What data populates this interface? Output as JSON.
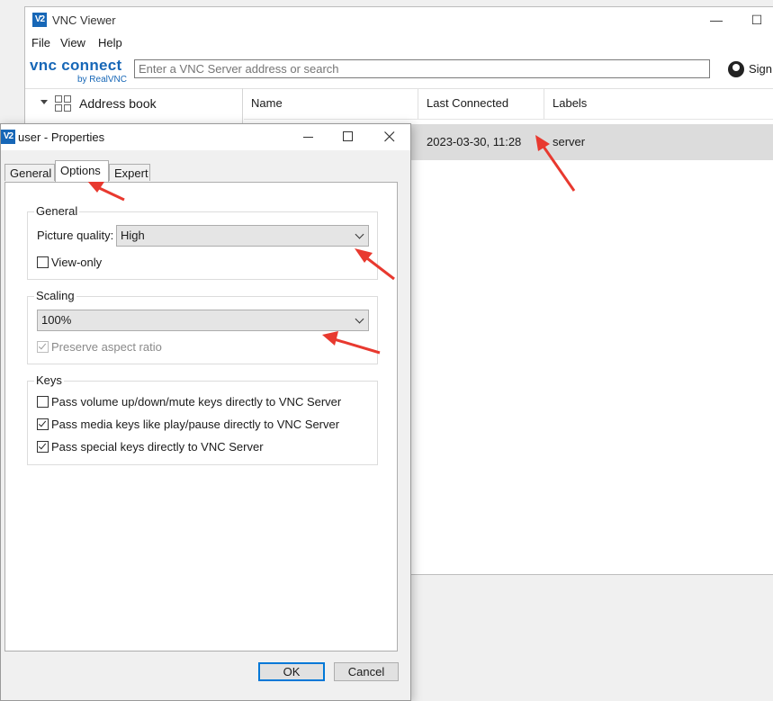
{
  "main_window": {
    "logo_glyph": "V2",
    "title": "VNC Viewer",
    "minimize_glyph": "—",
    "maximize_glyph": "☐",
    "menu": [
      "File",
      "View",
      "Help"
    ],
    "brand": {
      "name": "vnc connect",
      "by": "by RealVNC"
    },
    "search_placeholder": "Enter a VNC Server address or search",
    "sign_in_label": "Sign",
    "sidebar": {
      "address_book_label": "Address book"
    },
    "columns": [
      "Name",
      "Last Connected",
      "Labels"
    ],
    "rows": [
      {
        "last_connected": "2023-03-30, 11:28",
        "labels": "server"
      }
    ]
  },
  "dialog": {
    "logo_glyph": "V2",
    "title": "user - Properties",
    "tabs": [
      "General",
      "Options",
      "Expert"
    ],
    "active_tab": "Options",
    "general_group": {
      "legend": "General",
      "picture_quality_label": "Picture quality:",
      "picture_quality_value": "High",
      "view_only_label": "View-only",
      "view_only_checked": false
    },
    "scaling_group": {
      "legend": "Scaling",
      "scaling_value": "100%",
      "preserve_aspect_label": "Preserve aspect ratio",
      "preserve_aspect_checked": true,
      "preserve_aspect_disabled": true
    },
    "keys_group": {
      "legend": "Keys",
      "items": [
        {
          "label": "Pass volume up/down/mute keys directly to VNC Server",
          "checked": false
        },
        {
          "label": "Pass media keys like play/pause directly to VNC Server",
          "checked": true
        },
        {
          "label": "Pass special keys directly to VNC Server",
          "checked": true
        }
      ]
    },
    "ok_label": "OK",
    "cancel_label": "Cancel"
  },
  "colors": {
    "accent": "#1767b7",
    "annotation_arrow": "#e8392f",
    "selected_row": "#dcdcdc",
    "default_button_border": "#0078d7"
  }
}
